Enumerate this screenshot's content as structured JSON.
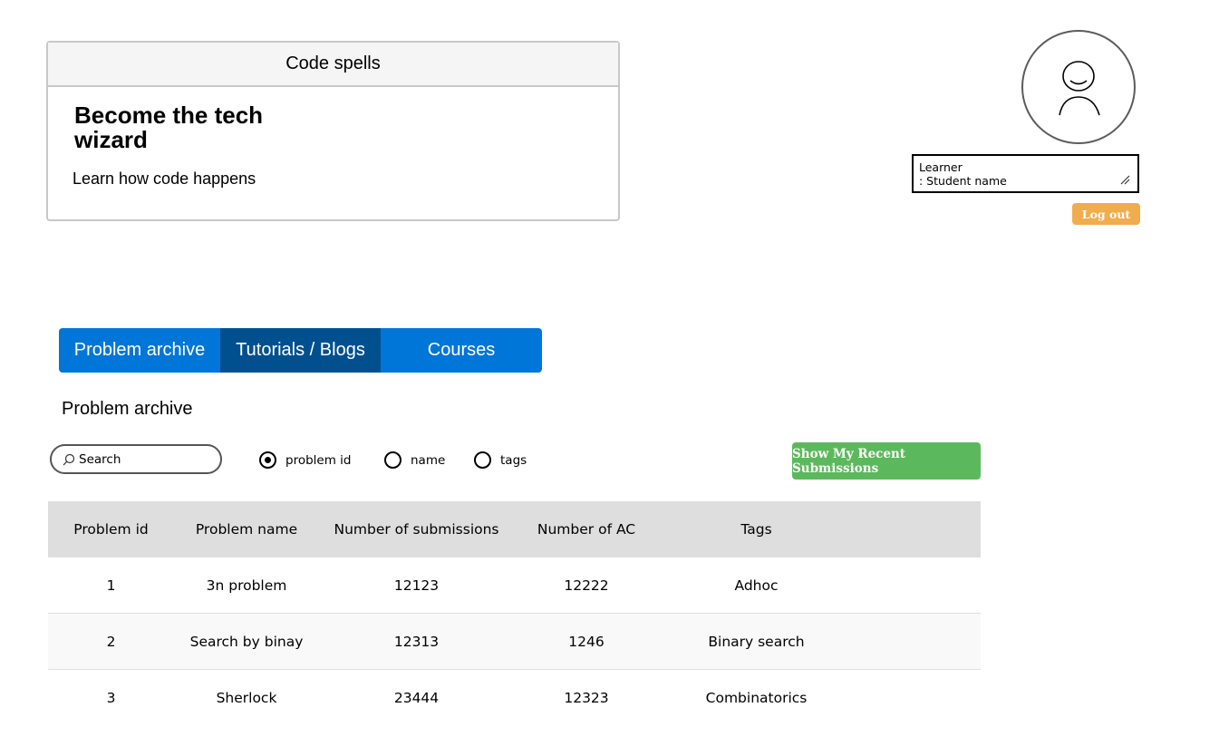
{
  "hero": {
    "header": "Code spells",
    "title": "Become the tech wizard",
    "subtitle": "Learn how code happens"
  },
  "profile": {
    "role_label": "Learner",
    "name_label": ": Student name",
    "logout_label": "Log out"
  },
  "tabs": [
    {
      "label": "Problem archive",
      "active": false
    },
    {
      "label": "Tutorials / Blogs",
      "active": true
    },
    {
      "label": "Courses",
      "active": false
    }
  ],
  "section_title": "Problem archive",
  "search": {
    "placeholder": "Search",
    "value": "",
    "filters": [
      {
        "label": "problem id",
        "checked": true
      },
      {
        "label": "name",
        "checked": false
      },
      {
        "label": "tags",
        "checked": false
      }
    ]
  },
  "recent_submissions_label": "Show My Recent Submissions",
  "table": {
    "columns": [
      "Problem id",
      "Problem name",
      "Number of submissions",
      "Number of AC",
      "Tags"
    ],
    "rows": [
      [
        "1",
        "3n problem",
        "12123",
        "12222",
        "Adhoc"
      ],
      [
        "2",
        "Search by binay",
        "12313",
        "1246",
        "Binary search"
      ],
      [
        "3",
        "Sherlock",
        "23444",
        "12323",
        "Combinatorics"
      ]
    ]
  },
  "colors": {
    "tab_blue": "#0076d8",
    "tab_active": "#00508f",
    "logout_orange": "#f0ad4e",
    "submit_green": "#5cb85c"
  }
}
